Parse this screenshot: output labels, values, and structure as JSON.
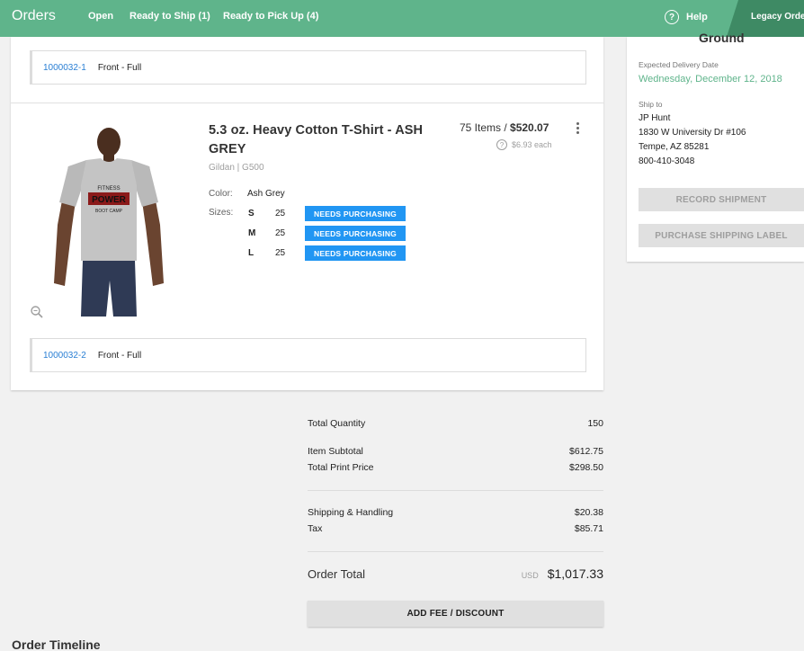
{
  "header": {
    "brand": "Orders",
    "nav": [
      {
        "label": "Open"
      },
      {
        "label": "Ready to Ship (1)"
      },
      {
        "label": "Ready to Pick Up (4)"
      }
    ],
    "help_label": "Help",
    "legacy_label": "Legacy Orders"
  },
  "locations": [
    {
      "id": "1000032-1",
      "desc": "Front - Full"
    },
    {
      "id": "1000032-2",
      "desc": "Front - Full"
    }
  ],
  "product": {
    "name": "5.3 oz. Heavy Cotton T-Shirt - ASH GREY",
    "brand": "Gildan | G500",
    "color_label": "Color:",
    "color_value": "Ash Grey",
    "sizes_label": "Sizes:",
    "sizes": [
      {
        "size": "S",
        "qty": "25",
        "status": "NEEDS PURCHASING"
      },
      {
        "size": "M",
        "qty": "25",
        "status": "NEEDS PURCHASING"
      },
      {
        "size": "L",
        "qty": "25",
        "status": "NEEDS PURCHASING"
      }
    ],
    "items_text": "75 Items / ",
    "price": "$520.07",
    "each": "$6.93 each",
    "shirt_text_top": "FITNESS",
    "shirt_text_main": "POWER",
    "shirt_text_bottom": "BOOT CAMP"
  },
  "shipping": {
    "method": "Ground",
    "delivery_label": "Expected Delivery Date",
    "delivery_date": "Wednesday, December 12, 2018",
    "ship_to_label": "Ship to",
    "name": "JP Hunt",
    "address1": "1830 W University Dr #106",
    "address2": "Tempe, AZ 85281",
    "phone": "800-410-3048",
    "record_button": "RECORD SHIPMENT",
    "label_button": "PURCHASE SHIPPING LABEL"
  },
  "totals": {
    "total_quantity_label": "Total Quantity",
    "total_quantity": "150",
    "item_subtotal_label": "Item Subtotal",
    "item_subtotal": "$612.75",
    "print_price_label": "Total Print Price",
    "print_price": "$298.50",
    "shipping_label": "Shipping & Handling",
    "shipping": "$20.38",
    "tax_label": "Tax",
    "tax": "$85.71",
    "order_total_label": "Order Total",
    "currency": "USD",
    "order_total": "$1,017.33",
    "add_fee_button": "ADD FEE / DISCOUNT"
  },
  "timeline_title": "Order Timeline",
  "colors": {
    "header": "#5fb48b",
    "legacy_tab": "#3e8a64",
    "badge": "#2196f3",
    "link": "#2a7fd4",
    "date": "#5fb48b"
  }
}
